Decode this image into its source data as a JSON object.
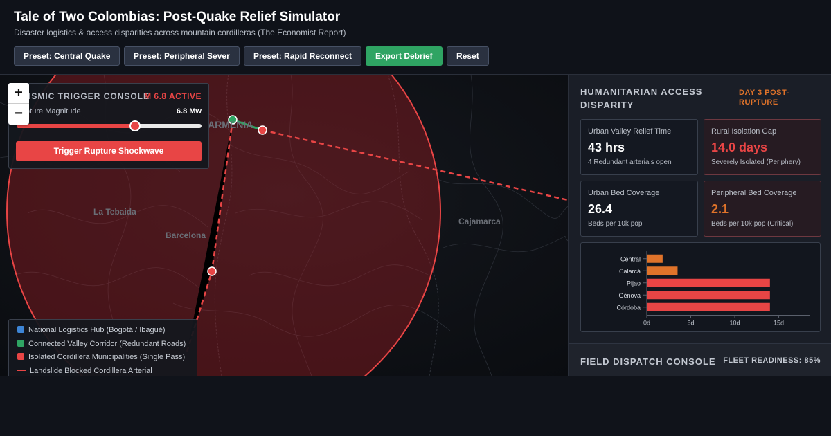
{
  "header": {
    "title": "Tale of Two Colombias: Post-Quake Relief Simulator",
    "subtitle": "Disaster logistics & access disparities across mountain cordilleras (The Economist Report)",
    "buttons": {
      "preset_central": "Preset: Central Quake",
      "preset_peripheral": "Preset: Peripheral Sever",
      "preset_rapid": "Preset: Rapid Reconnect",
      "export": "Export Debrief",
      "reset": "Reset"
    }
  },
  "map": {
    "zoom_in": "+",
    "zoom_out": "−",
    "places": {
      "armenia": "ARMENIA",
      "la_tebaida": "La Tebaida",
      "barcelona": "Barcelona",
      "cajamarca": "Cajamarca"
    },
    "colors": {
      "hub": "#3d85d6",
      "connected": "#2fa463",
      "isolated": "#e84545"
    },
    "console": {
      "title": "SEISMIC TRIGGER CONSOLE",
      "status": "M 6.8 ACTIVE",
      "magnitude_label": "Rupture Magnitude",
      "magnitude_value": "6.8 Mw",
      "magnitude_fraction": 0.64,
      "trigger_label": "Trigger Rupture Shockwave"
    },
    "legend": {
      "hub": "National Logistics Hub (Bogotá / Ibagué)",
      "connected": "Connected Valley Corridor (Redundant Roads)",
      "isolated": "Isolated Cordillera Municipalities (Single Pass)",
      "blocked": "Landslide Blocked Cordillera Arterial"
    }
  },
  "panel": {
    "title": "HUMANITARIAN ACCESS DISPARITY",
    "day_badge": "DAY 3 POST-RUPTURE",
    "cards": {
      "urban_relief": {
        "label": "Urban Valley Relief Time",
        "value": "43 hrs",
        "sub": "4 Redundant arterials open"
      },
      "rural_gap": {
        "label": "Rural Isolation Gap",
        "value": "14.0 days",
        "sub": "Severely Isolated (Periphery)"
      },
      "urban_beds": {
        "label": "Urban Bed Coverage",
        "value": "26.4",
        "sub": "Beds per 10k pop"
      },
      "peripheral_beds": {
        "label": "Peripheral Bed Coverage",
        "value": "2.1",
        "sub": "Beds per 10k pop (Critical)"
      }
    },
    "value_colors": {
      "alert": "#e84545",
      "warning": "#e0732a"
    },
    "dispatch": {
      "title": "FIELD DISPATCH CONSOLE",
      "fleet": "FLEET READINESS: 85%"
    }
  },
  "chart_data": {
    "type": "bar",
    "orientation": "horizontal",
    "categories": [
      "Central",
      "Calarcá",
      "Pijao",
      "Génova",
      "Córdoba"
    ],
    "values": [
      1.8,
      3.5,
      14.0,
      14.0,
      14.0
    ],
    "colors": [
      "#e0732a",
      "#e0732a",
      "#e84545",
      "#e84545",
      "#e84545"
    ],
    "ticks": [
      0,
      5,
      10,
      15
    ],
    "tick_labels": [
      "0d",
      "5d",
      "10d",
      "15d"
    ],
    "xlim": [
      0,
      18.5
    ],
    "grid": false
  }
}
